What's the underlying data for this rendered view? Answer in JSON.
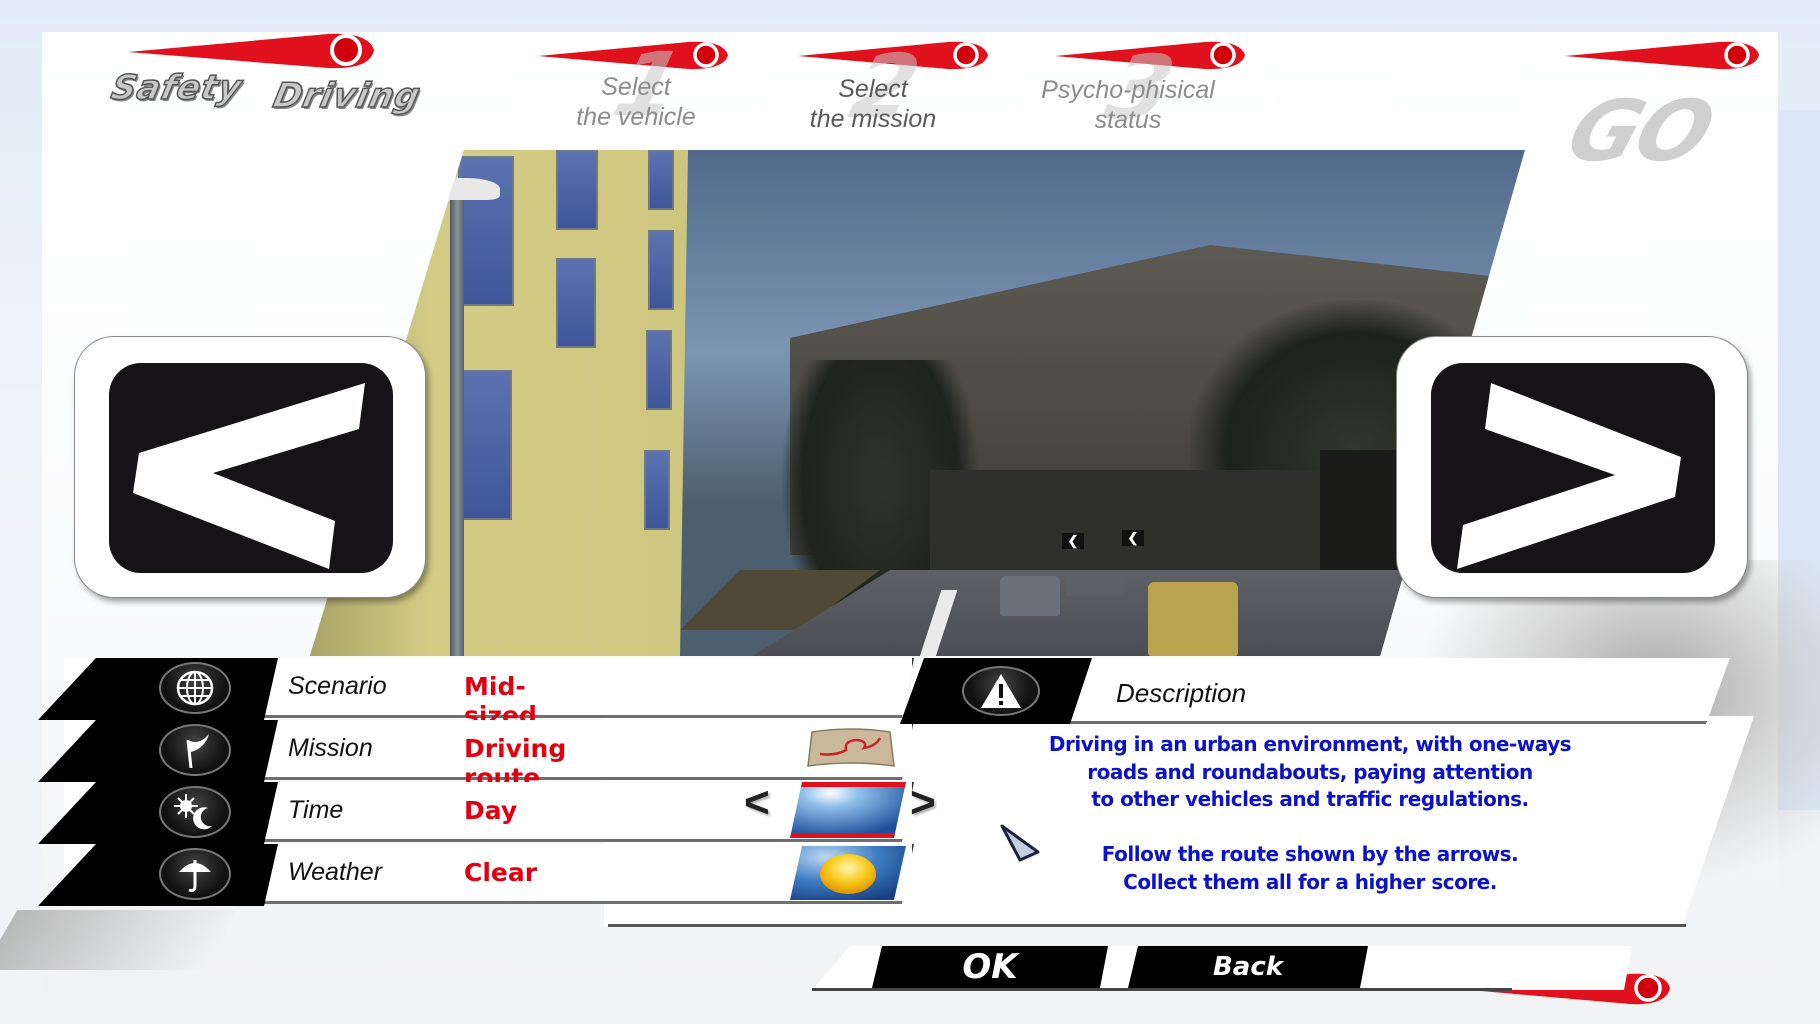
{
  "app": {
    "logo": {
      "word1": "Safety",
      "word2": "Driving"
    },
    "steps": [
      {
        "number": "1",
        "line1": "Select",
        "line2": "the vehicle",
        "active": false
      },
      {
        "number": "2",
        "line1": "Select",
        "line2": "the mission",
        "active": true
      },
      {
        "number": "3",
        "line1": "Psycho-phisical",
        "line2": "status",
        "active": false
      }
    ],
    "go_label": "GO"
  },
  "navigation": {
    "prev_icon": "chevron-left-icon",
    "next_icon": "chevron-right-icon"
  },
  "settings": [
    {
      "key": "scenario",
      "label": "Scenario",
      "value": "Mid-sized Town",
      "icon": "globe-icon"
    },
    {
      "key": "mission",
      "label": "Mission",
      "value": "Driving route",
      "icon": "flag-icon",
      "thumbnail": "route-map-icon"
    },
    {
      "key": "time",
      "label": "Time",
      "value": "Day",
      "icon": "sun-moon-icon",
      "thumbnail": "day-sky-icon",
      "prev": "<",
      "next": ">"
    },
    {
      "key": "weather",
      "label": "Weather",
      "value": "Clear",
      "icon": "umbrella-icon",
      "thumbnail": "sun-icon"
    }
  ],
  "description": {
    "title": "Description",
    "icon": "warning-icon",
    "lines": [
      "Driving in an urban environment, with one-ways",
      "roads and roundabouts, paying attention",
      "to other vehicles and traffic regulations.",
      "",
      "Follow the route shown by the arrows.",
      "Collect them all for a higher score."
    ]
  },
  "buttons": {
    "ok": "OK",
    "back": "Back"
  },
  "colors": {
    "accent_red": "#e00010",
    "description_blue": "#0b12c8",
    "tab_black": "#000000"
  }
}
